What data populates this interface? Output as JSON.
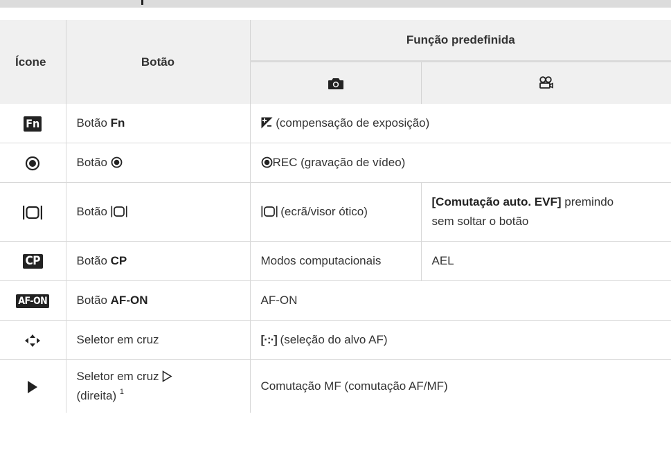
{
  "header": {
    "icon": "Ícone",
    "button": "Botão",
    "default_function": "Função predefinida",
    "photo_icon": "camera-icon",
    "movie_icon": "movie-camera-icon"
  },
  "rows": [
    {
      "icon": "Fn",
      "button_prefix": "Botão ",
      "button_bold": "Fn",
      "function_text": " (compensação de exposição)",
      "function_icon": "exposure-compensation-icon"
    },
    {
      "icon_name": "record-icon",
      "button_prefix": "Botão ",
      "function_text": "REC (gravação de vídeo)"
    },
    {
      "icon_name": "lv-icon",
      "button_prefix": "Botão ",
      "photo_function": " (ecrã/visor ótico)",
      "movie_function_bold": "[Comutação auto. EVF]",
      "movie_function_line1": " premindo",
      "movie_function_line2": "sem soltar o botão"
    },
    {
      "icon": "CP",
      "button_prefix": "Botão ",
      "button_bold": "CP",
      "photo_function": "Modos computacionais",
      "movie_function": "AEL"
    },
    {
      "icon": "AF-ON",
      "button_prefix": "Botão ",
      "button_bold": "AF-ON",
      "function_text": "AF-ON"
    },
    {
      "icon_name": "cross-selector-icon",
      "button_text": "Seletor em cruz",
      "function_icon_text": "[·:·]",
      "function_text": " (seleção do alvo AF)"
    },
    {
      "icon_name": "play-icon",
      "button_line1": "Seletor em cruz ",
      "button_line2": "(direita) ",
      "footnote": "1",
      "function_text": "Comutação MF (comutação AF/MF)"
    }
  ]
}
